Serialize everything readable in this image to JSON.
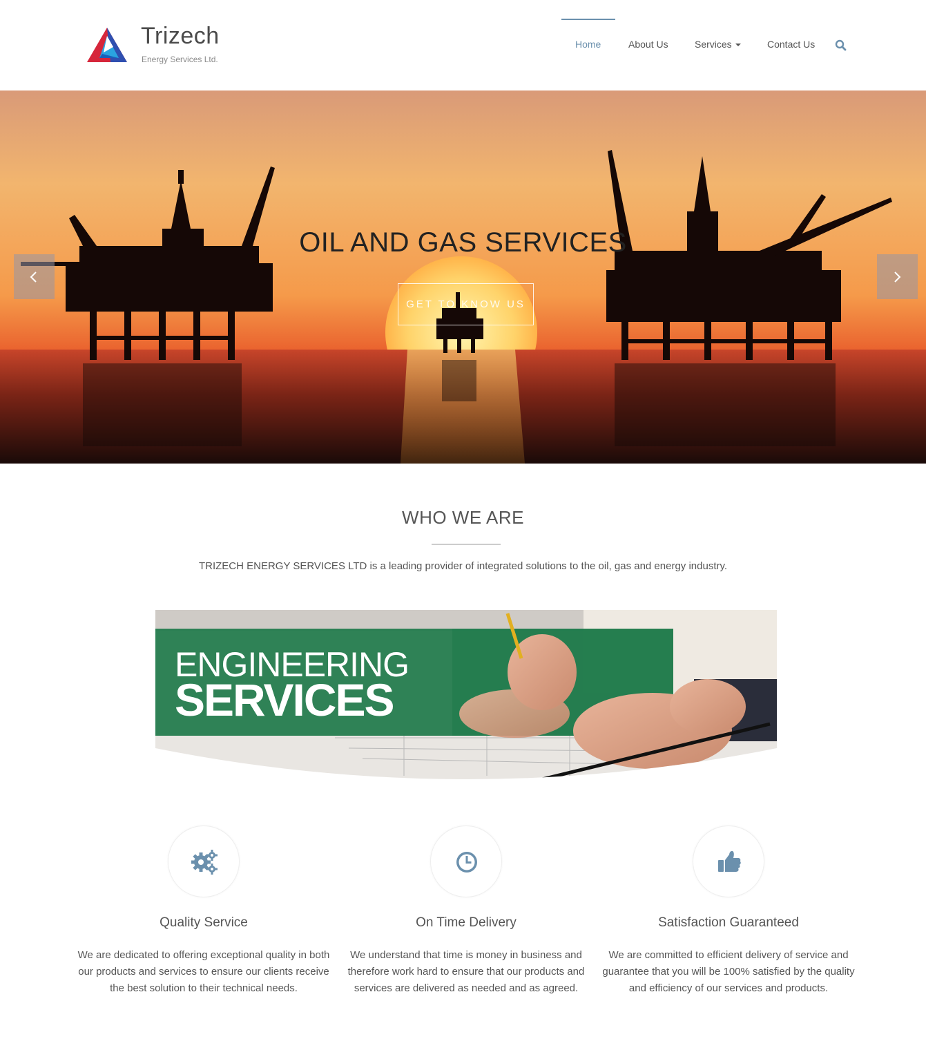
{
  "brand": {
    "name": "Trizech",
    "subtitle": "Energy Services Ltd."
  },
  "nav": {
    "items": [
      {
        "label": "Home",
        "active": true
      },
      {
        "label": "About Us",
        "active": false
      },
      {
        "label": "Services",
        "active": false,
        "has_dropdown": true
      },
      {
        "label": "Contact Us",
        "active": false
      }
    ],
    "search_icon": "search-icon"
  },
  "hero": {
    "title": "OIL AND GAS SERVICES",
    "button_label": "GET TO KNOW US",
    "prev_icon": "chevron-left-icon",
    "next_icon": "chevron-right-icon"
  },
  "about": {
    "title": "WHO WE ARE",
    "text": "TRIZECH ENERGY SERVICES LTD is a leading provider of integrated solutions to the oil, gas and energy industry."
  },
  "banner": {
    "line1": "ENGINEERING",
    "line2": "SERVICES"
  },
  "features": [
    {
      "icon": "gears-icon",
      "title": "Quality Service",
      "text": "We are dedicated to offering exceptional quality in both our products and services to ensure our clients receive the best solution to their technical needs."
    },
    {
      "icon": "clock-icon",
      "title": "On Time Delivery",
      "text": "We understand that time is money in business and therefore work hard to ensure that our products and services are delivered as needed and as agreed."
    },
    {
      "icon": "thumbs-up-icon",
      "title": "Satisfaction Guaranteed",
      "text": "We are committed to efficient delivery of service and guarantee that you will be 100% satisfied by the quality and efficiency of our services and products."
    }
  ],
  "colors": {
    "accent": "#6b90ad",
    "banner_green": "#1e7a4a",
    "text": "#555555"
  }
}
